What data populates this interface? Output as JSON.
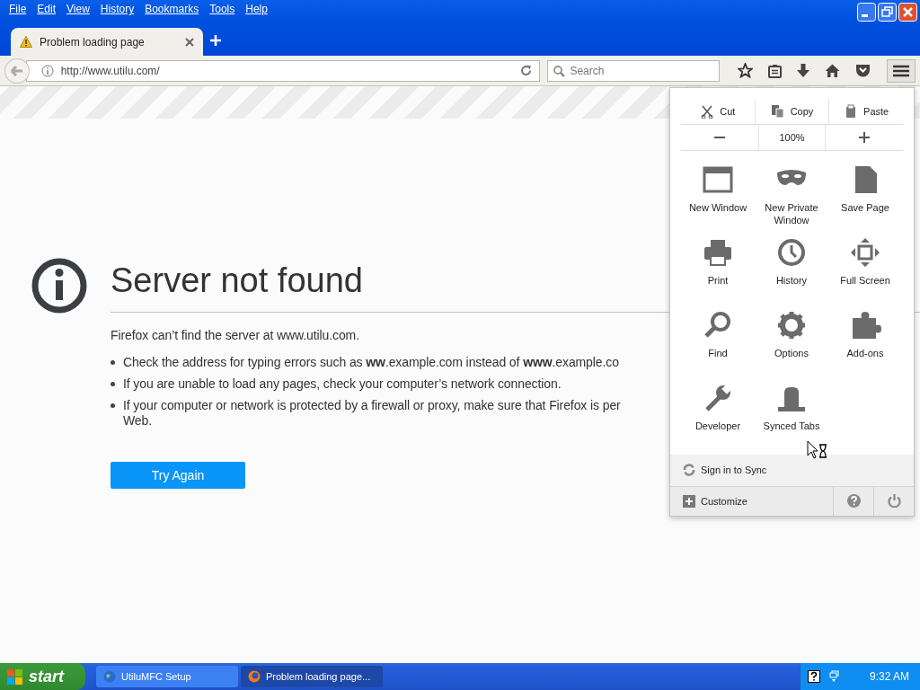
{
  "menubar": [
    {
      "label": "File"
    },
    {
      "label": "Edit"
    },
    {
      "label": "View"
    },
    {
      "label": "History"
    },
    {
      "label": "Bookmarks"
    },
    {
      "label": "Tools"
    },
    {
      "label": "Help"
    }
  ],
  "tabs": [
    {
      "title": "Problem loading page",
      "selected": true
    }
  ],
  "address_bar": {
    "value": "http://www.utilu.com/"
  },
  "search": {
    "placeholder": "Search"
  },
  "error_page": {
    "title": "Server not found",
    "message": "Firefox can’t find the server at www.utilu.com.",
    "bullets": [
      {
        "text": "Check the address for typing errors such as **ww**.example.com instead of **www**.example.co"
      },
      {
        "text": "If you are unable to load any pages, check your computer’s network connection."
      },
      {
        "text": "If your computer or network is protected by a firewall or proxy, make sure that Firefox is per",
        "continuation": "Web."
      }
    ],
    "button": "Try Again"
  },
  "menu_panel": {
    "edit_row": [
      "Cut",
      "Copy",
      "Paste"
    ],
    "zoom": "100%",
    "items": [
      "New Window",
      "New Private Window",
      "Save Page",
      "Print",
      "History",
      "Full Screen",
      "Find",
      "Options",
      "Add-ons",
      "Developer",
      "Synced Tabs"
    ],
    "sync": "Sign in to Sync",
    "customize": "Customize"
  },
  "taskbar": {
    "start": "start",
    "tasks": [
      {
        "label": "UtiluMFC Setup",
        "selected": false
      },
      {
        "label": "Problem loading page...",
        "selected": true
      }
    ],
    "clock": "9:32 AM"
  }
}
